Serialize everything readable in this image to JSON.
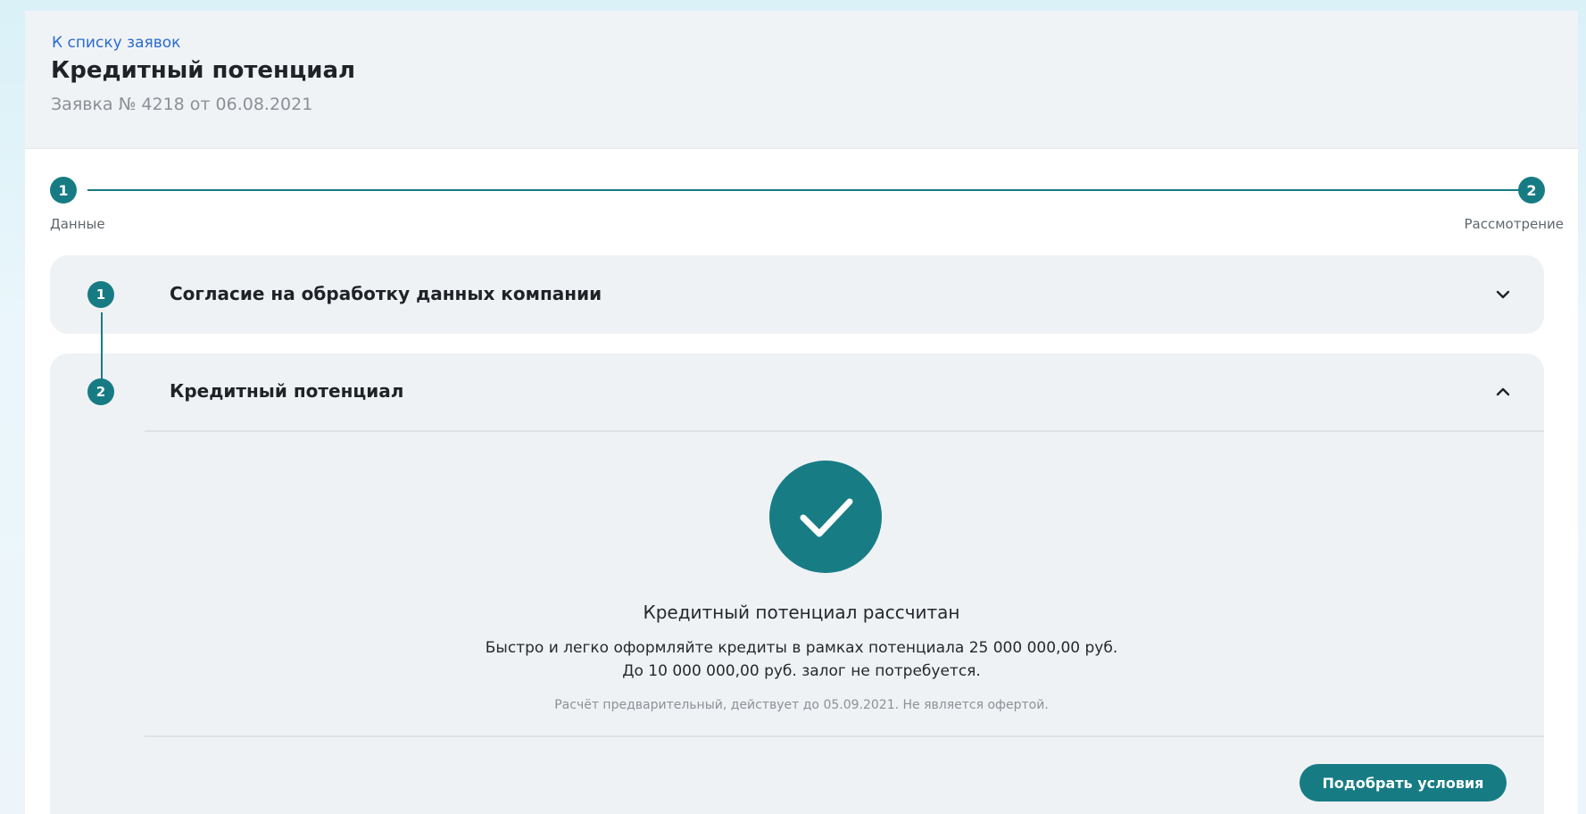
{
  "header": {
    "back_link": "К списку заявок",
    "title": "Кредитный потенциал",
    "subtitle": "Заявка № 4218 от 06.08.2021"
  },
  "stepper": {
    "steps": [
      {
        "number": "1",
        "label": "Данные"
      },
      {
        "number": "2",
        "label": "Рассмотрение"
      }
    ]
  },
  "accordion": {
    "sections": [
      {
        "number": "1",
        "title": "Согласие на обработку данных компании",
        "expanded": false,
        "icon": "chevron-down-icon"
      },
      {
        "number": "2",
        "title": "Кредитный потенциал",
        "expanded": true,
        "icon": "chevron-up-icon"
      }
    ]
  },
  "result": {
    "icon": "check-icon",
    "title": "Кредитный потенциал рассчитан",
    "line1": "Быстро и легко оформляйте кредиты в рамках потенциала 25 000 000,00 руб.",
    "line2": "До 10 000 000,00 руб. залог не потребуется.",
    "note": "Расчёт предварительный, действует до 05.09.2021. Не является офертой."
  },
  "actions": {
    "primary_label": "Подобрать условия"
  },
  "colors": {
    "accent": "#177b84",
    "link": "#2a6bd1",
    "card_bg": "#eff2f5"
  }
}
